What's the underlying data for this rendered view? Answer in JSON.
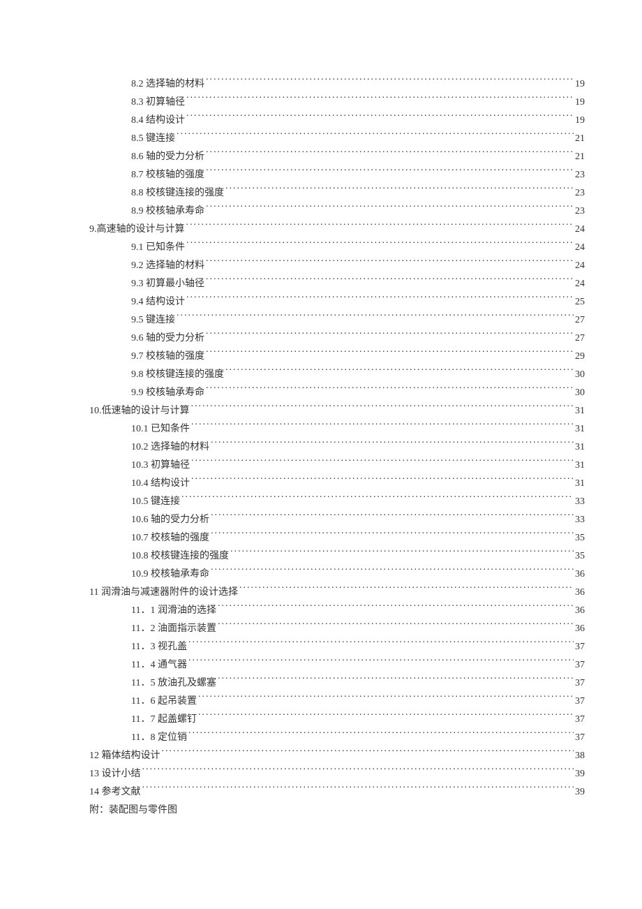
{
  "toc": [
    {
      "level": 2,
      "title": "8.2 选择轴的材料",
      "page": "19"
    },
    {
      "level": 2,
      "title": "8.3 初算轴径",
      "page": "19"
    },
    {
      "level": 2,
      "title": "8.4 结构设计",
      "page": "19"
    },
    {
      "level": 2,
      "title": "8.5 键连接",
      "page": "21"
    },
    {
      "level": 2,
      "title": "8.6 轴的受力分析",
      "page": "21"
    },
    {
      "level": 2,
      "title": "8.7 校核轴的强度",
      "page": "23"
    },
    {
      "level": 2,
      "title": "8.8 校核键连接的强度",
      "page": "23"
    },
    {
      "level": 2,
      "title": "8.9 校核轴承寿命",
      "page": "23"
    },
    {
      "level": 1,
      "title": "9.高速轴的设计与计算",
      "page": "24"
    },
    {
      "level": 2,
      "title": "9.1 已知条件",
      "page": "24"
    },
    {
      "level": 2,
      "title": "9.2 选择轴的材料",
      "page": "24"
    },
    {
      "level": 2,
      "title": "9.3 初算最小轴径",
      "page": "24"
    },
    {
      "level": 2,
      "title": "9.4 结构设计",
      "page": "25"
    },
    {
      "level": 2,
      "title": "9.5 键连接",
      "page": "27"
    },
    {
      "level": 2,
      "title": "9.6 轴的受力分析",
      "page": "27"
    },
    {
      "level": 2,
      "title": "9.7 校核轴的强度",
      "page": "29"
    },
    {
      "level": 2,
      "title": "9.8 校核键连接的强度",
      "page": "30"
    },
    {
      "level": 2,
      "title": "9.9 校核轴承寿命",
      "page": "30"
    },
    {
      "level": 1,
      "title": "10.低速轴的设计与计算",
      "page": "31"
    },
    {
      "level": 2,
      "title": "10.1 已知条件",
      "page": "31"
    },
    {
      "level": 2,
      "title": "10.2 选择轴的材料",
      "page": "31"
    },
    {
      "level": 2,
      "title": "10.3 初算轴径",
      "page": "31"
    },
    {
      "level": 2,
      "title": "10.4 结构设计",
      "page": "31"
    },
    {
      "level": 2,
      "title": "10.5 键连接",
      "page": "33"
    },
    {
      "level": 2,
      "title": "10.6 轴的受力分析",
      "page": "33"
    },
    {
      "level": 2,
      "title": "10.7 校核轴的强度",
      "page": "35"
    },
    {
      "level": 2,
      "title": "10.8 校核键连接的强度",
      "page": "35"
    },
    {
      "level": 2,
      "title": "10.9 校核轴承寿命",
      "page": "36"
    },
    {
      "level": 1,
      "title": "11  润滑油与减速器附件的设计选择",
      "page": "36",
      "sparse_dots": true
    },
    {
      "level": 2,
      "title": "11．1 润滑油的选择",
      "page": "36"
    },
    {
      "level": 2,
      "title": "11．2 油面指示装置",
      "page": "36"
    },
    {
      "level": 2,
      "title": "11．3 视孔盖",
      "page": "37"
    },
    {
      "level": 2,
      "title": "11．4 通气器",
      "page": "37"
    },
    {
      "level": 2,
      "title": "11．5 放油孔及螺塞",
      "page": "37"
    },
    {
      "level": 2,
      "title": "11．6 起吊装置",
      "page": "37"
    },
    {
      "level": 2,
      "title": "11．7 起盖螺钉",
      "page": "37"
    },
    {
      "level": 2,
      "title": "11．8 定位销",
      "page": "37"
    },
    {
      "level": 1,
      "title": "12 箱体结构设计",
      "page": "38"
    },
    {
      "level": 1,
      "title": "13 设计小结",
      "page": "39"
    },
    {
      "level": 1,
      "title": "14 参考文献",
      "page": "39"
    }
  ],
  "appendix_line": "附：装配图与零件图"
}
